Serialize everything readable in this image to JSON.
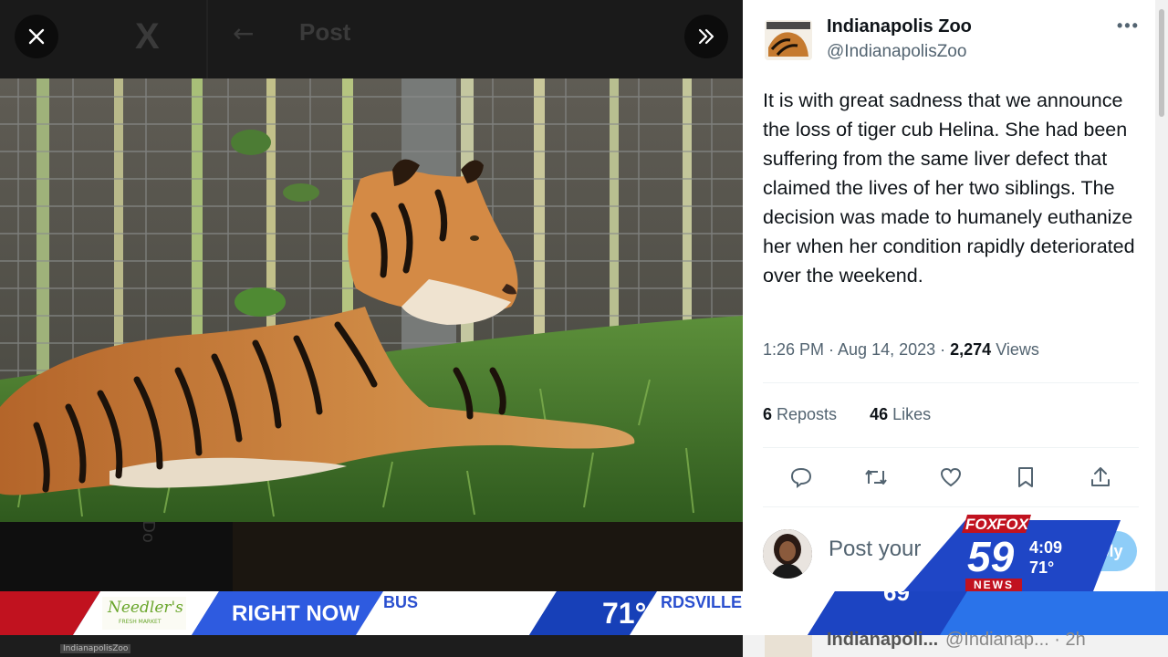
{
  "viewer": {
    "topbar_ghost": {
      "back_arrow": "←",
      "title": "Post"
    },
    "close_icon": "close-icon",
    "expand_icon": "chevrons-right-icon",
    "sidebar_ghost": "Do"
  },
  "tweet": {
    "display_name": "Indianapolis Zoo",
    "handle": "@IndianapolisZoo",
    "more": "•••",
    "text": "It is with great sadness that we announce the loss of tiger cub Helina. She had been suffering from the same liver defect that claimed the lives of her two siblings. The decision was made to humanely euthanize her when her condition rapidly deteriorated over the weekend.",
    "time": "1:26 PM · Aug 14, 2023 · ",
    "views_count": "2,274",
    "views_label": " Views",
    "reposts_count": "6",
    "reposts_label": " Reposts",
    "likes_count": "46",
    "likes_label": " Likes",
    "actions": [
      "reply-icon",
      "repost-icon",
      "like-icon",
      "bookmark-icon",
      "share-icon"
    ],
    "reply_placeholder": "Post your",
    "reply_button": "Reply"
  },
  "next_tweet_ghost": {
    "name": "Indianapoli...",
    "handle": "@Indianap... · 2h"
  },
  "ticker": {
    "sponsor": "Needler's",
    "sponsor_sub": "FRESH MARKET",
    "label": "RIGHT NOW",
    "city1": "BUS",
    "temp1": "71°",
    "city2": "RDSVILLE",
    "temp3_partial": "69"
  },
  "bug": {
    "brand": "FOX",
    "number": "59",
    "news": "NEWS",
    "time": "4:09",
    "temp": "71°"
  },
  "watermark": "IndianapolisZoo",
  "colors": {
    "ticker_blue": "#1e3fae",
    "ticker_red": "#c1121f",
    "reply_button": "#8ecdf8",
    "secondary_text": "#536471"
  }
}
